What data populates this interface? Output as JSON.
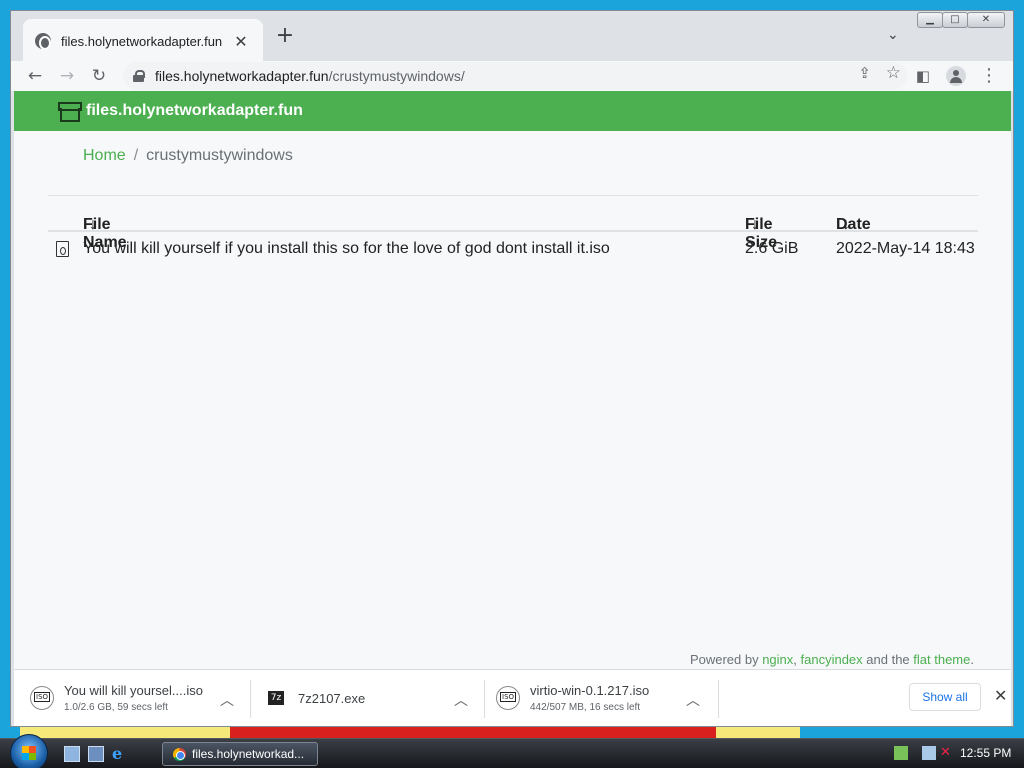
{
  "browser": {
    "tab_title": "files.holynetworkadapter.fun",
    "url_host": "files.holynetworkadapter.fun",
    "url_path": "/crustymustywindows/"
  },
  "site": {
    "title": "files.holynetworkadapter.fun",
    "breadcrumb": {
      "home": "Home",
      "separator": "/",
      "current": "crustymustywindows"
    },
    "columns": [
      "File Name",
      "File Size",
      "Date"
    ],
    "sort_arrow": "↓",
    "files": [
      {
        "name": "You will kill yourself if you install this so for the love of god dont install it.iso",
        "size": "2.6 GiB",
        "date": "2022-May-14 18:43"
      }
    ],
    "footer": {
      "prefix": "Powered by ",
      "link1": "nginx",
      "sep": ", ",
      "link2": "fancyindex",
      "mid": " and the ",
      "link3": "flat theme",
      "suffix": "."
    },
    "header_color": "#4caf50"
  },
  "downloads": {
    "items": [
      {
        "name": "You will kill yoursel....iso",
        "status": "1.0/2.6 GB, 59 secs left",
        "icon": "iso-disc-icon"
      },
      {
        "name": "7z2107.exe",
        "status": "",
        "icon": "7zip-icon",
        "icon_text": "7z"
      },
      {
        "name": "virtio-win-0.1.217.iso",
        "status": "442/507 MB, 16 secs left",
        "icon": "iso-disc-icon"
      }
    ],
    "show_all": "Show all"
  },
  "taskbar": {
    "task_label": "files.holynetworkad...",
    "clock": "12:55 PM"
  }
}
